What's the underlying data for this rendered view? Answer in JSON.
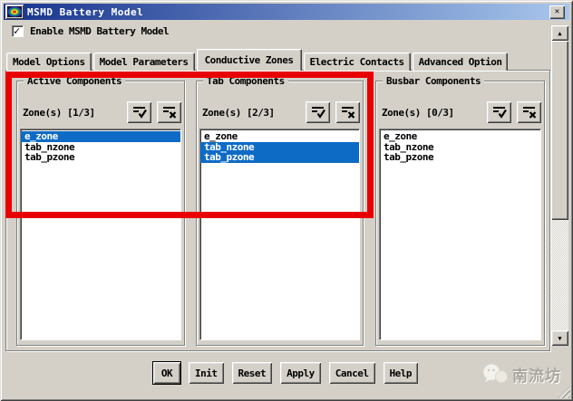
{
  "window": {
    "title": "MSMD Battery Model"
  },
  "icons": {
    "close": "✕",
    "scroll_up": "▲",
    "scroll_down": "▼"
  },
  "checkbox": {
    "label": "Enable MSMD Battery Model",
    "checked": true
  },
  "tabs": [
    {
      "label": "Model Options",
      "active": false
    },
    {
      "label": "Model Parameters",
      "active": false
    },
    {
      "label": "Conductive Zones",
      "active": true
    },
    {
      "label": "Electric Contacts",
      "active": false
    },
    {
      "label": "Advanced Option",
      "active": false
    }
  ],
  "groups": [
    {
      "title": "Active Components",
      "zone_label": "Zone(s) [1/3]",
      "items": [
        {
          "label": "e_zone",
          "selected": true
        },
        {
          "label": "tab_nzone",
          "selected": false
        },
        {
          "label": "tab_pzone",
          "selected": false
        }
      ]
    },
    {
      "title": "Tab Components",
      "zone_label": "Zone(s) [2/3]",
      "items": [
        {
          "label": "e_zone",
          "selected": false
        },
        {
          "label": "tab_nzone",
          "selected": true
        },
        {
          "label": "tab_pzone",
          "selected": true
        }
      ]
    },
    {
      "title": "Busbar Components",
      "zone_label": "Zone(s) [0/3]",
      "items": [
        {
          "label": "e_zone",
          "selected": false
        },
        {
          "label": "tab_nzone",
          "selected": false
        },
        {
          "label": "tab_pzone",
          "selected": false
        }
      ]
    }
  ],
  "footer": {
    "buttons": [
      "OK",
      "Init",
      "Reset",
      "Apply",
      "Cancel",
      "Help"
    ]
  },
  "watermark": {
    "text": "南流坊"
  },
  "colors": {
    "selection_blue": "#0e6bc5",
    "annotation_red": "#e80000",
    "titlebar_left": "#16338e",
    "titlebar_right": "#a8c6ec",
    "chrome_gray": "#d4d0c8"
  }
}
